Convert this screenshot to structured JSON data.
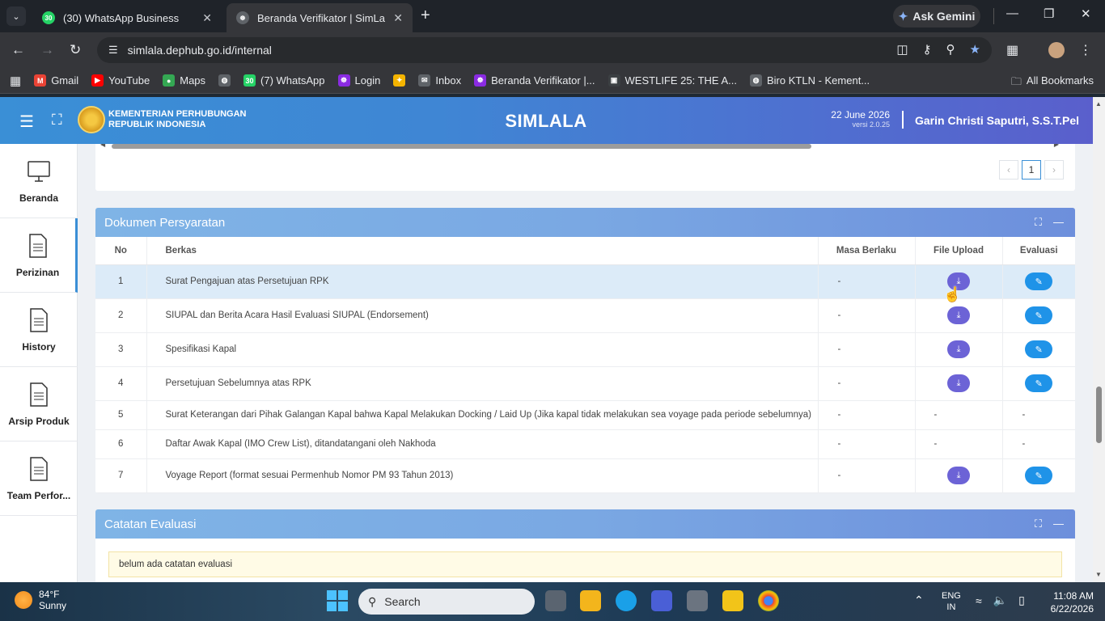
{
  "browser": {
    "tabs": [
      {
        "title": "(30) WhatsApp Business",
        "favicon_label": "30",
        "color": "#25d366"
      },
      {
        "title": "Beranda Verifikator | SimLala",
        "favicon_label": "☸",
        "color": "#5f6368"
      }
    ],
    "gemini_label": "Ask Gemini",
    "url": "simlala.dephub.go.id/internal",
    "bookmarks": [
      {
        "label": "Gmail",
        "icon": "gmail-icon",
        "glyph": "M",
        "color": "#ea4335"
      },
      {
        "label": "YouTube",
        "icon": "youtube-icon",
        "glyph": "▶",
        "color": "#ff0000"
      },
      {
        "label": "Maps",
        "icon": "maps-icon",
        "glyph": "●",
        "color": "#34a853"
      },
      {
        "label": "",
        "icon": "globe-icon",
        "glyph": "◍",
        "color": "#5f6368"
      },
      {
        "label": "(7) WhatsApp",
        "icon": "whatsapp-icon",
        "glyph": "30",
        "color": "#25d366"
      },
      {
        "label": "Login",
        "icon": "login-icon",
        "glyph": "☸",
        "color": "#8a2be2"
      },
      {
        "label": "",
        "icon": "pinwheel-icon",
        "glyph": "✦",
        "color": "#f4b400"
      },
      {
        "label": "Inbox",
        "icon": "inbox-icon",
        "glyph": "✉",
        "color": "#5f6368"
      },
      {
        "label": "Beranda Verifikator |...",
        "icon": "simlala-icon",
        "glyph": "☸",
        "color": "#8a2be2"
      },
      {
        "label": "WESTLIFE 25: THE A...",
        "icon": "page-icon",
        "glyph": "▣",
        "color": "#3c4043"
      },
      {
        "label": "Biro KTLN - Kement...",
        "icon": "globe-icon",
        "glyph": "◍",
        "color": "#5f6368"
      }
    ],
    "all_bookmarks": "All Bookmarks"
  },
  "header": {
    "ministry_line1": "KEMENTERIAN PERHUBUNGAN",
    "ministry_line2": "REPUBLIK INDONESIA",
    "title": "SIMLALA",
    "date": "22 June 2026",
    "version": "versi 2.0.25",
    "user": "Garin Christi Saputri, S.S.T.Pel"
  },
  "sidebar": {
    "items": [
      {
        "label": "Beranda",
        "icon": "monitor-icon",
        "active": false
      },
      {
        "label": "Perizinan",
        "icon": "document-icon",
        "active": true
      },
      {
        "label": "History",
        "icon": "document-icon",
        "active": false
      },
      {
        "label": "Arsip Produk",
        "icon": "document-icon",
        "active": false
      },
      {
        "label": "Team Perfor...",
        "icon": "document-icon",
        "active": false
      }
    ]
  },
  "pagination": {
    "prev": "‹",
    "current": "1",
    "next": "›"
  },
  "dokumen": {
    "title": "Dokumen Persyaratan",
    "columns": {
      "no": "No",
      "berkas": "Berkas",
      "masa": "Masa Berlaku",
      "file": "File Upload",
      "eval": "Evaluasi"
    },
    "rows": [
      {
        "no": "1",
        "berkas": "Surat Pengajuan atas Persetujuan RPK",
        "masa": "-",
        "file": true,
        "eval": true
      },
      {
        "no": "2",
        "berkas": "SIUPAL dan Berita Acara Hasil Evaluasi SIUPAL (Endorsement)",
        "masa": "-",
        "file": true,
        "eval": true
      },
      {
        "no": "3",
        "berkas": "Spesifikasi Kapal",
        "masa": "-",
        "file": true,
        "eval": true
      },
      {
        "no": "4",
        "berkas": "Persetujuan Sebelumnya atas RPK",
        "masa": "-",
        "file": true,
        "eval": true
      },
      {
        "no": "5",
        "berkas": "Surat Keterangan dari Pihak Galangan Kapal bahwa Kapal Melakukan Docking / Laid Up (Jika kapal tidak melakukan sea voyage pada periode sebelumnya)",
        "masa": "-",
        "file": false,
        "file_text": "-",
        "eval": false,
        "eval_text": "-"
      },
      {
        "no": "6",
        "berkas": "Daftar Awak Kapal (IMO Crew List), ditandatangani oleh Nakhoda",
        "masa": "-",
        "file": false,
        "file_text": "-",
        "eval": false,
        "eval_text": "-"
      },
      {
        "no": "7",
        "berkas": "Voyage Report (format sesuai Permenhub Nomor PM 93 Tahun 2013)",
        "masa": "-",
        "file": true,
        "eval": true
      }
    ]
  },
  "catatan": {
    "title": "Catatan Evaluasi",
    "note": "belum ada catatan evaluasi"
  },
  "taskbar": {
    "temp": "84°F",
    "weather": "Sunny",
    "search_placeholder": "Search",
    "lang1": "ENG",
    "lang2": "IN",
    "time": "11:08 AM",
    "date": "6/22/2026"
  },
  "colors": {
    "accent": "#3a8fd6",
    "download_button": "#6c63d6",
    "edit_button": "#1f93e8"
  }
}
